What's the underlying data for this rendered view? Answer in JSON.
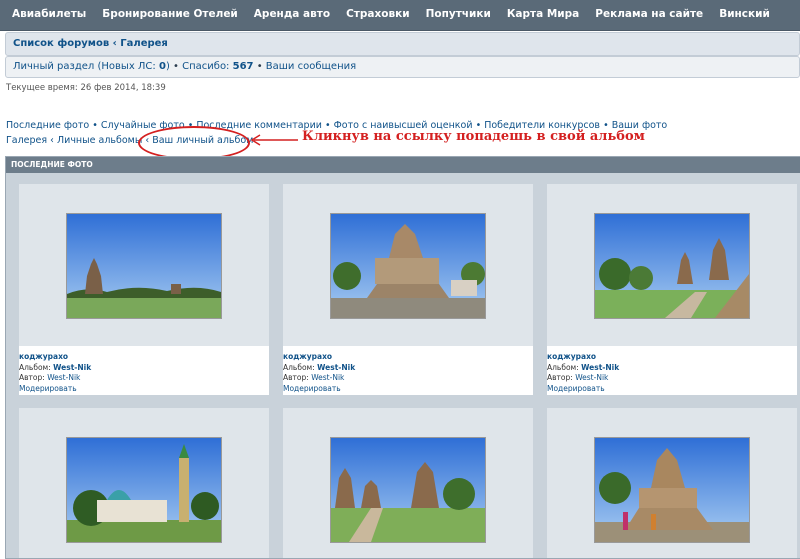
{
  "nav": [
    "Авиабилеты",
    "Бронирование Отелей",
    "Аренда авто",
    "Страховки",
    "Попутчики",
    "Карта Мира",
    "Реклама на сайте",
    "Винский"
  ],
  "breadcrumb": {
    "forums": "Список форумов",
    "sep": "‹",
    "gallery": "Галерея"
  },
  "userbar": {
    "personal": "Личный раздел",
    "new_pm_prefix": "(Новых ЛС: ",
    "new_pm": "0",
    "new_pm_suffix": ")",
    "thanks_label": "Спасибо:",
    "thanks_count": "567",
    "messages": "Ваши сообщения",
    "bullet": "•"
  },
  "current_time": "Текущее время: 26 фев 2014, 18:39",
  "gallery_links": [
    "Последние фото",
    "Случайные фото",
    "Последние комментарии",
    "Фото с наивысшей оценкой",
    "Победители конкурсов",
    "Ваши фото"
  ],
  "gallery_crumbs": {
    "gallery": "Галерея",
    "personal_albums": "Личные альбомы",
    "your_album": "Ваш личный альбом",
    "sep": "‹"
  },
  "annotation": "Кликнув на ссылку попадешь в свой альбом",
  "panel_title": "ПОСЛЕДНИЕ ФОТО",
  "photos": [
    {
      "title": "коджурахо",
      "album_label": "Альбом:",
      "album": "West-Nik",
      "author_label": "Автор:",
      "author": "West-Nik",
      "moderate": "Модерировать"
    },
    {
      "title": "коджурахо",
      "album_label": "Альбом:",
      "album": "West-Nik",
      "author_label": "Автор:",
      "author": "West-Nik",
      "moderate": "Модерировать"
    },
    {
      "title": "коджурахо",
      "album_label": "Альбом:",
      "album": "West-Nik",
      "author_label": "Автор:",
      "author": "West-Nik",
      "moderate": "Модерировать"
    }
  ],
  "colors": {
    "link": "#105289",
    "annotation": "#d42020",
    "nav_bg": "#5a6a78"
  }
}
